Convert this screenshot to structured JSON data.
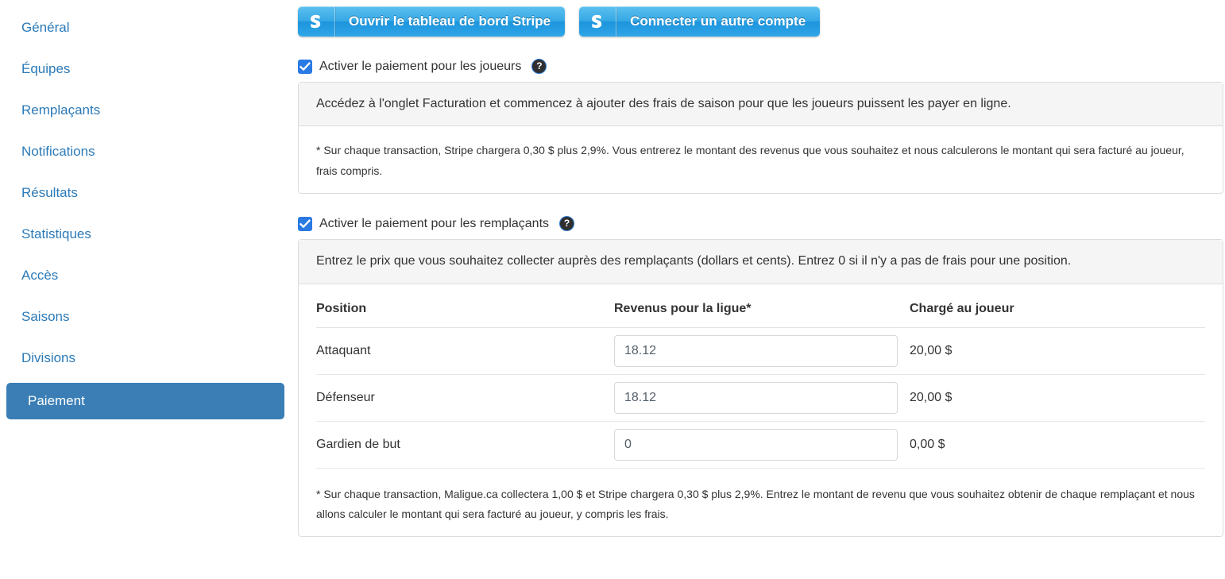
{
  "sidebar": {
    "items": [
      {
        "label": "Général",
        "active": false
      },
      {
        "label": "Équipes",
        "active": false
      },
      {
        "label": "Remplaçants",
        "active": false
      },
      {
        "label": "Notifications",
        "active": false
      },
      {
        "label": "Résultats",
        "active": false
      },
      {
        "label": "Statistiques",
        "active": false
      },
      {
        "label": "Accès",
        "active": false
      },
      {
        "label": "Saisons",
        "active": false
      },
      {
        "label": "Divisions",
        "active": false
      },
      {
        "label": "Paiement",
        "active": true
      }
    ],
    "active_color": "#3a7eb5",
    "link_color": "#2b7ab8"
  },
  "toolbar": {
    "dashboard_button": "Ouvrir le tableau de bord Stripe",
    "connect_button": "Connecter un autre compte",
    "logo_letter": "S",
    "button_color": "#2fa6e8"
  },
  "players_section": {
    "checkbox_label": "Activer le paiement pour les joueurs",
    "checked": true,
    "help_glyph": "?",
    "panel_header": "Accédez à l'onglet Facturation et commencez à ajouter des frais de saison pour que les joueurs puissent les payer en ligne.",
    "fineprint": "* Sur chaque transaction, Stripe chargera 0,30 $ plus 2,9%. Vous entrerez le montant des revenus que vous souhaitez et nous calculerons le montant qui sera facturé au joueur, frais compris."
  },
  "substitutes_section": {
    "checkbox_label": "Activer le paiement pour les remplaçants",
    "checked": true,
    "help_glyph": "?",
    "panel_header": "Entrez le prix que vous souhaitez collecter auprès des remplaçants (dollars et cents). Entrez 0 si il n'y a pas de frais pour une position.",
    "table": {
      "headers": {
        "position": "Position",
        "revenue": "Revenus pour la ligue*",
        "charged": "Chargé au joueur"
      },
      "rows": [
        {
          "position": "Attaquant",
          "revenue_value": "18.12",
          "charged": "20,00 $"
        },
        {
          "position": "Défenseur",
          "revenue_value": "18.12",
          "charged": "20,00 $"
        },
        {
          "position": "Gardien de but",
          "revenue_value": "0",
          "charged": "0,00 $"
        }
      ]
    },
    "fineprint": "* Sur chaque transaction, Maligue.ca collectera 1,00 $ et Stripe chargera 0,30 $ plus 2,9%. Entrez le montant de revenu que vous souhaitez obtenir de chaque remplaçant et nous allons calculer le montant qui sera facturé au joueur, y compris les frais."
  }
}
